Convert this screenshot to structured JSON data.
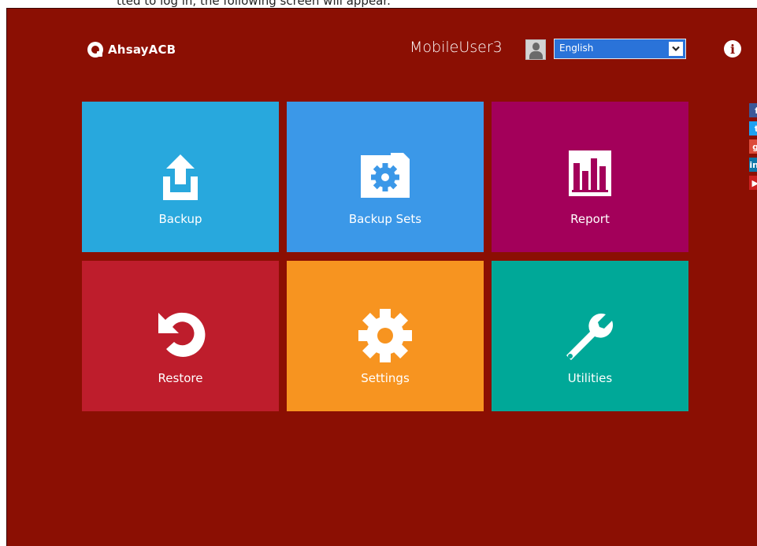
{
  "page": {
    "top_strip_text": "tted to log in, the following screen will appear."
  },
  "header": {
    "logo_text": "AhsayACB",
    "username": "MobileUser3",
    "language": "English"
  },
  "tiles": [
    {
      "label": "Backup",
      "color": "#28a8dd",
      "icon": "upload-icon"
    },
    {
      "label": "Backup Sets",
      "color": "#3b98e8",
      "icon": "folder-gear-icon"
    },
    {
      "label": "Report",
      "color": "#a3005a",
      "icon": "bar-chart-icon"
    },
    {
      "label": "Restore",
      "color": "#be1d2c",
      "icon": "restore-icon"
    },
    {
      "label": "Settings",
      "color": "#f79420",
      "icon": "gear-icon"
    },
    {
      "label": "Utilities",
      "color": "#00a898",
      "icon": "wrench-icon"
    }
  ],
  "social": [
    {
      "icon": "facebook-icon",
      "glyph": "f",
      "color": "#3b5998"
    },
    {
      "icon": "twitter-icon",
      "glyph": "t",
      "color": "#1da1f2"
    },
    {
      "icon": "google-plus-icon",
      "glyph": "g",
      "color": "#dd4b39"
    },
    {
      "icon": "linkedin-icon",
      "glyph": "in",
      "color": "#0e76a8"
    },
    {
      "icon": "youtube-icon",
      "glyph": "▶",
      "color": "#cd201f"
    }
  ],
  "colors": {
    "window_background": "#8b0f03",
    "language_select": "#2a73d9"
  }
}
